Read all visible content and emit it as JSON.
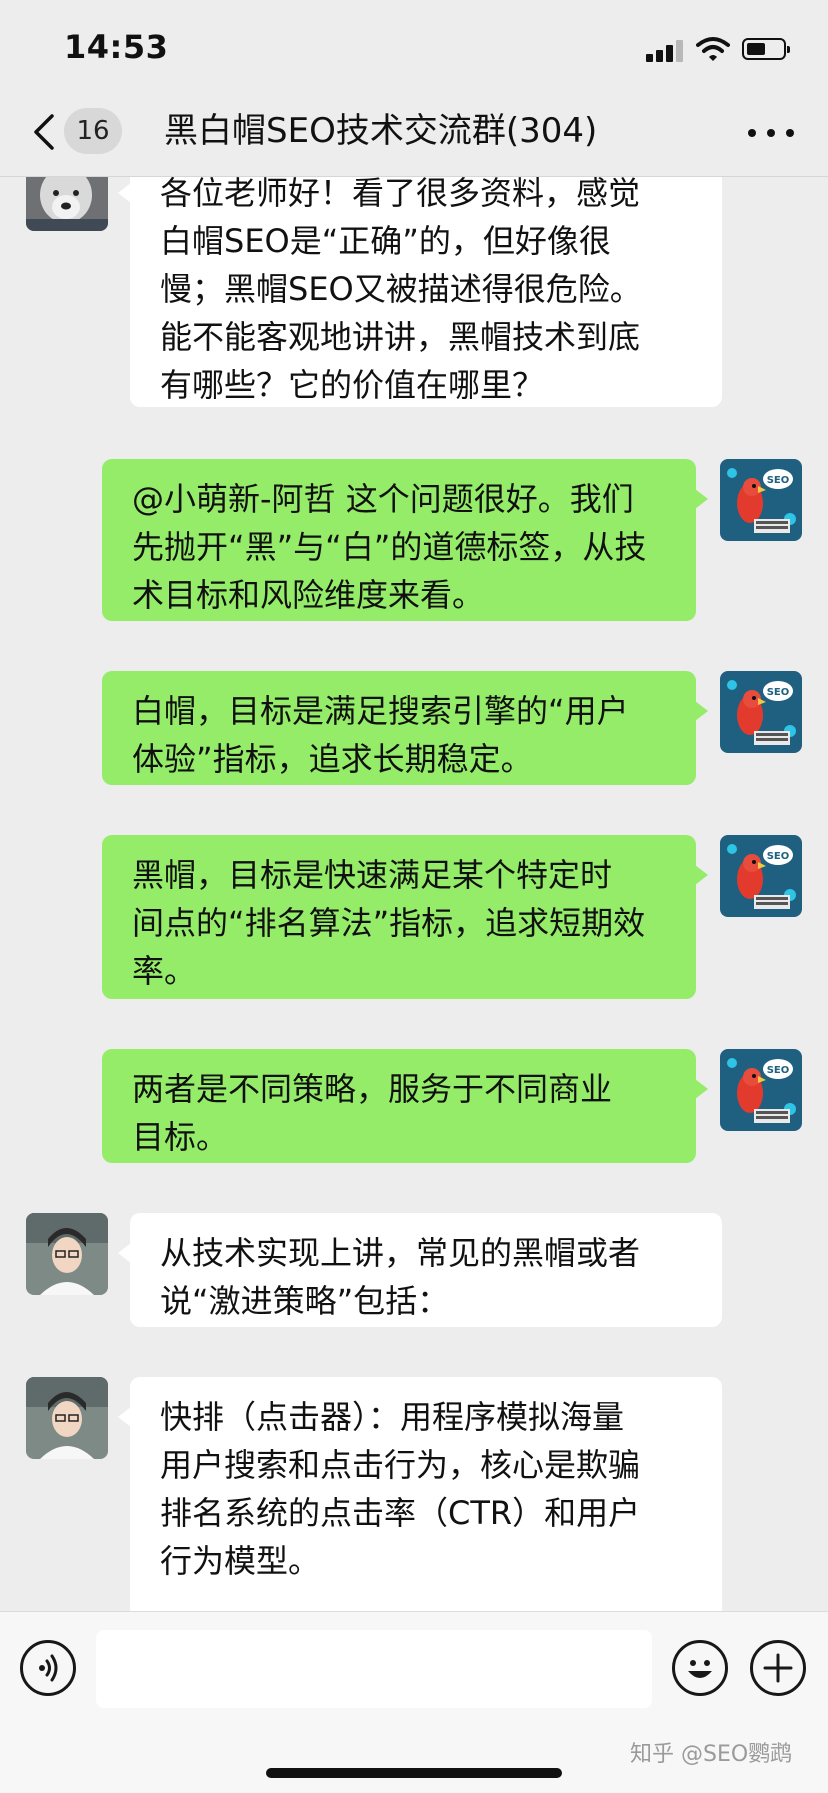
{
  "status_bar": {
    "time": "14:53"
  },
  "nav": {
    "unread_count": "16",
    "title": "黑白帽SEO技术交流群(304)"
  },
  "messages": [
    {
      "side": "in",
      "avatar": "wolf-avatar",
      "lines": [
        "各位老师好！看了很多资料，感觉",
        "白帽SEO是“正确”的，但好像很",
        "慢；黑帽SEO又被描述得很危险。",
        "能不能客观地讲讲，黑帽技术到底",
        "有哪些？它的价值在哪里？"
      ]
    },
    {
      "side": "out",
      "avatar": "seo-parrot-avatar",
      "lines": [
        "@小萌新-阿哲 这个问题很好。我们",
        "先抛开“黑”与“白”的道德标签，从技",
        "术目标和风险维度来看。"
      ]
    },
    {
      "side": "out",
      "avatar": "seo-parrot-avatar",
      "lines": [
        "白帽，目标是满足搜索引擎的“用户",
        "体验”指标，追求长期稳定。"
      ]
    },
    {
      "side": "out",
      "avatar": "seo-parrot-avatar",
      "lines": [
        "黑帽，目标是快速满足某个特定时",
        "间点的“排名算法”指标，追求短期效",
        "率。"
      ]
    },
    {
      "side": "out",
      "avatar": "seo-parrot-avatar",
      "lines": [
        "两者是不同策略，服务于不同商业",
        "目标。"
      ]
    },
    {
      "side": "in",
      "avatar": "young-man-avatar",
      "lines": [
        "从技术实现上讲，常见的黑帽或者",
        "说“激进策略”包括："
      ]
    },
    {
      "side": "in",
      "avatar": "young-man-avatar",
      "lines": [
        "快排（点击器）：用程序模拟海量",
        "用户搜索和点击行为，核心是欺骗",
        "排名系统的点击率（CTR）和用户",
        "行为模型。"
      ]
    }
  ],
  "input_bar": {
    "placeholder": ""
  },
  "watermark": "知乎 @SEO鹦鹉",
  "colors": {
    "outgoing_bubble": "#95ec69",
    "incoming_bubble": "#ffffff",
    "background": "#ededed"
  }
}
